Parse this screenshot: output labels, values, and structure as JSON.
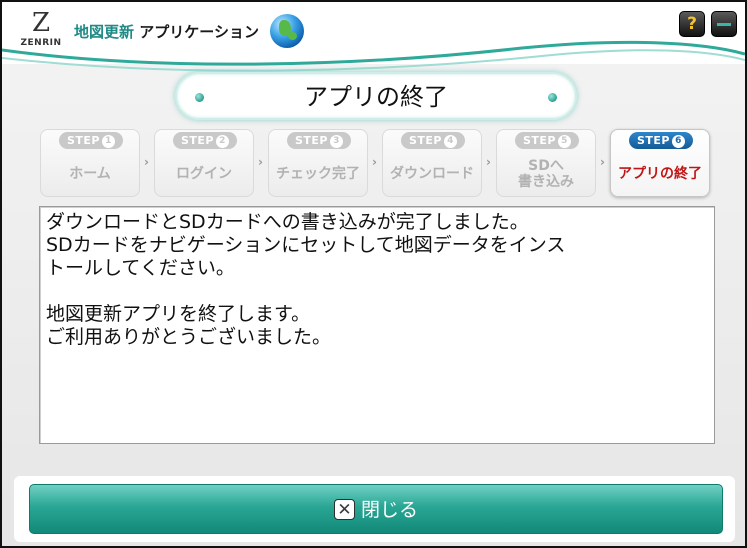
{
  "header": {
    "logo_mark": "Z",
    "logo_text": "ZENRIN",
    "title_accent": "地図更新",
    "title_rest": " アプリケーション",
    "help_label": "?",
    "icons": {
      "globe": "globe-icon",
      "help": "help-icon",
      "minimize": "minimize-icon"
    }
  },
  "page_title": "アプリの終了",
  "steps": [
    {
      "badge": "STEP",
      "num": "1",
      "label": "ホーム"
    },
    {
      "badge": "STEP",
      "num": "2",
      "label": "ログイン"
    },
    {
      "badge": "STEP",
      "num": "3",
      "label": "チェック完了"
    },
    {
      "badge": "STEP",
      "num": "4",
      "label": "ダウンロード"
    },
    {
      "badge": "STEP",
      "num": "5",
      "label": "SDへ\n書き込み"
    },
    {
      "badge": "STEP",
      "num": "6",
      "label": "アプリの終了"
    }
  ],
  "active_step": 6,
  "step_separator": "›",
  "message": "ダウンロードとSDカードへの書き込みが完了しました。\nSDカードをナビゲーションにセットして地図データをインス\nトールしてください。\n\n地図更新アプリを終了します。\nご利用ありがとうございました。",
  "footer": {
    "close_label": "閉じる",
    "close_icon_glyph": "✕"
  },
  "colors": {
    "accent_teal": "#1f8a86",
    "button_teal": "#2aa694",
    "active_step_text": "#c01515",
    "active_badge": "#1c6cae"
  }
}
